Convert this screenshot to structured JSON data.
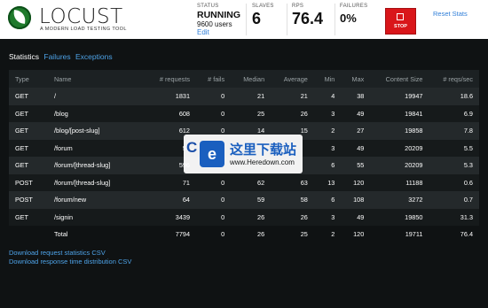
{
  "header": {
    "logo_text": "LOCUST",
    "tagline": "A MODERN LOAD TESTING TOOL",
    "status": {
      "label": "STATUS",
      "value": "RUNNING",
      "users": "9600 users",
      "edit": "Edit"
    },
    "slaves": {
      "label": "SLAVES",
      "value": "6"
    },
    "rps": {
      "label": "RPS",
      "value": "76.4"
    },
    "failures": {
      "label": "FAILURES",
      "value": "0%"
    },
    "stop_label": "STOP",
    "reset_label": "Reset Stats",
    "colors": {
      "stop": "#d9161a",
      "link": "#2f7ed8",
      "logo": "#1f7a2c"
    }
  },
  "tabs": [
    {
      "label": "Statistics",
      "active": true
    },
    {
      "label": "Failures",
      "active": false
    },
    {
      "label": "Exceptions",
      "active": false
    }
  ],
  "table": {
    "columns": [
      "Type",
      "Name",
      "# requests",
      "# fails",
      "Median",
      "Average",
      "Min",
      "Max",
      "Content Size",
      "# reqs/sec"
    ],
    "rows": [
      [
        "GET",
        "/",
        "1831",
        "0",
        "21",
        "21",
        "4",
        "38",
        "19947",
        "18.6"
      ],
      [
        "GET",
        "/blog",
        "608",
        "0",
        "25",
        "26",
        "3",
        "49",
        "19841",
        "6.9"
      ],
      [
        "GET",
        "/blog/[post-slug]",
        "612",
        "0",
        "14",
        "15",
        "2",
        "27",
        "19858",
        "7.8"
      ],
      [
        "GET",
        "/forum",
        "57",
        "",
        "",
        "",
        "3",
        "49",
        "20209",
        "5.5"
      ],
      [
        "GET",
        "/forum/[thread-slug]",
        "596",
        "",
        "",
        "",
        "6",
        "55",
        "20209",
        "5.3"
      ],
      [
        "POST",
        "/forum/[thread-slug]",
        "71",
        "0",
        "62",
        "63",
        "13",
        "120",
        "11188",
        "0.6"
      ],
      [
        "POST",
        "/forum/new",
        "64",
        "0",
        "59",
        "58",
        "6",
        "108",
        "3272",
        "0.7"
      ],
      [
        "GET",
        "/signin",
        "3439",
        "0",
        "26",
        "26",
        "3",
        "49",
        "19850",
        "31.3"
      ]
    ],
    "total": [
      "",
      "Total",
      "7794",
      "0",
      "26",
      "25",
      "2",
      "120",
      "19711",
      "76.4"
    ]
  },
  "downloads": {
    "request_csv": "Download request statistics CSV",
    "response_csv": "Download response time distribution CSV"
  },
  "watermark": {
    "letter": "C",
    "badge": "e",
    "title": "这里下载站",
    "url": "www.Heredown.com"
  }
}
